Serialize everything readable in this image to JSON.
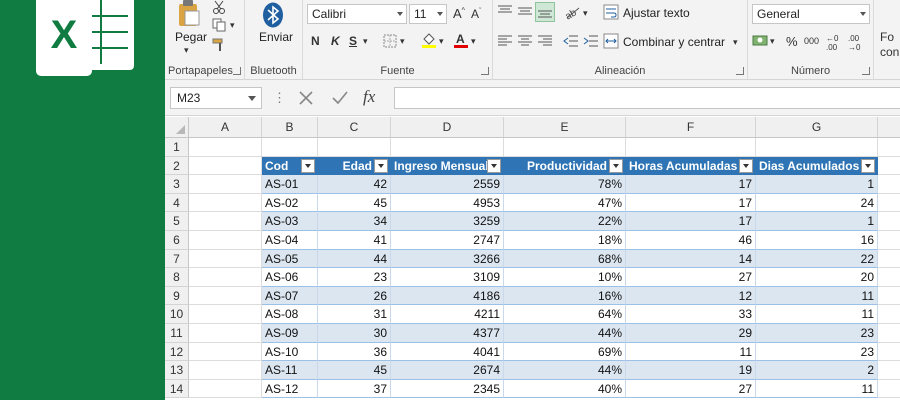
{
  "ribbon": {
    "clipboard": {
      "paste_label": "Pegar",
      "group_label": "Portapapeles"
    },
    "bluetooth": {
      "send_label": "Enviar",
      "group_label": "Bluetooth"
    },
    "font": {
      "family": "Calibri",
      "size": "11",
      "bold": "N",
      "italic": "K",
      "underline": "S",
      "group_label": "Fuente"
    },
    "alignment": {
      "wrap_text": "Ajustar texto",
      "merge_center": "Combinar y centrar",
      "group_label": "Alineación"
    },
    "number": {
      "format": "General",
      "percent": "%",
      "thousands": "000",
      "increase_decimals": "←0 .00",
      "decrease_decimals": ".00 →0",
      "group_label": "Número"
    },
    "cut_off_text": {
      "line1": "Fo",
      "line2": "con"
    }
  },
  "formula_bar": {
    "name_box": "M23",
    "fx": "fx",
    "formula": ""
  },
  "grid": {
    "columns": [
      "A",
      "B",
      "C",
      "D",
      "E",
      "F",
      "G"
    ],
    "rows": [
      "1",
      "2",
      "3",
      "4",
      "5",
      "6",
      "7",
      "8",
      "9",
      "10",
      "11",
      "12",
      "13",
      "14"
    ],
    "table": {
      "headers": [
        "Cod",
        "Edad",
        "Ingreso Mensual",
        "Productividad",
        "Horas Acumuladas",
        "Dias Acumulados"
      ],
      "records": [
        [
          "AS-01",
          "42",
          "2559",
          "78%",
          "17",
          "1"
        ],
        [
          "AS-02",
          "45",
          "4953",
          "47%",
          "17",
          "24"
        ],
        [
          "AS-03",
          "34",
          "3259",
          "22%",
          "17",
          "1"
        ],
        [
          "AS-04",
          "41",
          "2747",
          "18%",
          "46",
          "16"
        ],
        [
          "AS-05",
          "44",
          "3266",
          "68%",
          "14",
          "22"
        ],
        [
          "AS-06",
          "23",
          "3109",
          "10%",
          "27",
          "20"
        ],
        [
          "AS-07",
          "26",
          "4186",
          "16%",
          "12",
          "11"
        ],
        [
          "AS-08",
          "31",
          "4211",
          "64%",
          "33",
          "11"
        ],
        [
          "AS-09",
          "30",
          "4377",
          "44%",
          "29",
          "23"
        ],
        [
          "AS-10",
          "36",
          "4041",
          "69%",
          "11",
          "23"
        ],
        [
          "AS-11",
          "45",
          "2674",
          "44%",
          "19",
          "2"
        ],
        [
          "AS-12",
          "37",
          "2345",
          "40%",
          "27",
          "11"
        ]
      ]
    }
  },
  "colors": {
    "brand_green": "#107c41",
    "table_header": "#2f75b5",
    "table_band": "#dce6f1"
  }
}
